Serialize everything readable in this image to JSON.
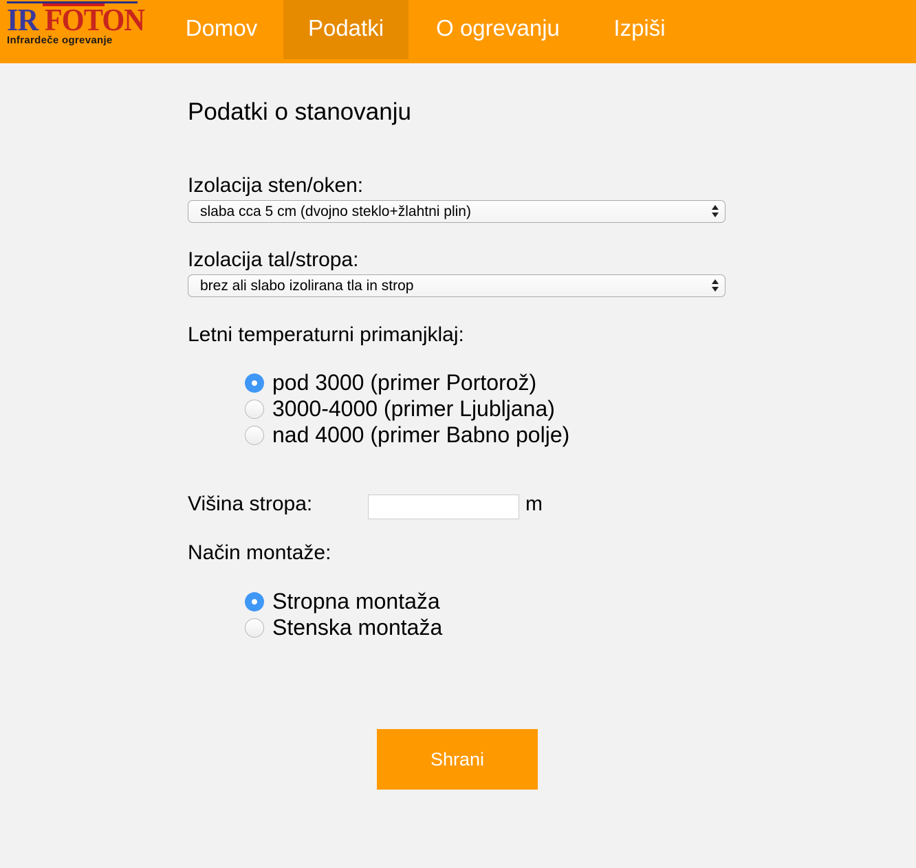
{
  "logo": {
    "part1": "IR",
    "part2": "FOTON",
    "subtitle": "Infrardeče ogrevanje"
  },
  "nav": {
    "items": [
      {
        "label": "Domov",
        "active": false
      },
      {
        "label": "Podatki",
        "active": true
      },
      {
        "label": "O ogrevanju",
        "active": false
      },
      {
        "label": "Izpiši",
        "active": false
      }
    ]
  },
  "form": {
    "title": "Podatki o stanovanju",
    "walls": {
      "label": "Izolacija sten/oken:",
      "selected": "slaba cca 5 cm (dvojno steklo+žlahtni plin)"
    },
    "floor": {
      "label": "Izolacija tal/stropa:",
      "selected": "brez ali slabo izolirana tla in strop"
    },
    "temperature": {
      "label": "Letni temperaturni primanjklaj:",
      "options": [
        {
          "label": "pod 3000 (primer Portorož)",
          "checked": true
        },
        {
          "label": "3000-4000 (primer Ljubljana)",
          "checked": false
        },
        {
          "label": "nad 4000 (primer Babno polje)",
          "checked": false
        }
      ]
    },
    "height": {
      "label": "Višina stropa:",
      "value": "",
      "unit": "m"
    },
    "mounting": {
      "label": "Način montaže:",
      "options": [
        {
          "label": "Stropna montaža",
          "checked": true
        },
        {
          "label": "Stenska montaža",
          "checked": false
        }
      ]
    },
    "save_label": "Shrani"
  },
  "colors": {
    "navbar": "#ff9900",
    "nav_active": "#e68a00",
    "background": "#f2f2f2",
    "radio_checked": "#3f97f6",
    "button": "#ff9900"
  }
}
